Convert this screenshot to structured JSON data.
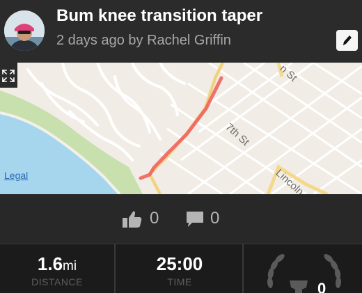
{
  "header": {
    "title": "Bum knee transition taper",
    "subtitle": "2 days ago by Rachel Griffin"
  },
  "map": {
    "legal_label": "Legal",
    "streets": [
      "Lincoln",
      "7th St",
      "n St"
    ]
  },
  "social": {
    "likes": "0",
    "comments": "0"
  },
  "stats": {
    "distance_value": "1.6",
    "distance_unit": "mi",
    "distance_label": "DISTANCE",
    "time_value": "25:00",
    "time_label": "TIME"
  },
  "colors": {
    "route": "#ee5a5a",
    "water": "#a6d6ee",
    "park": "#c8dfae",
    "link": "#2d6ab1"
  }
}
